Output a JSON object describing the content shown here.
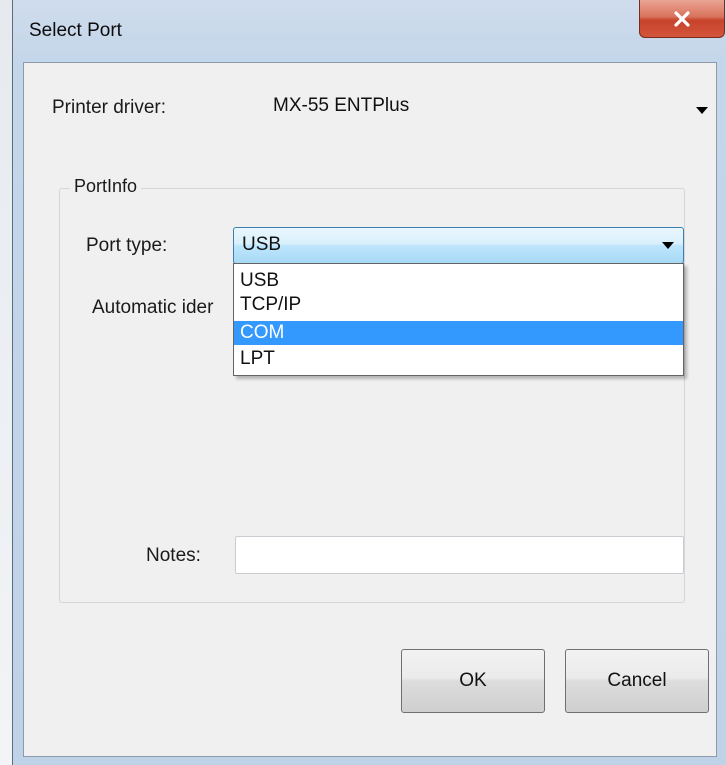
{
  "window": {
    "title": "Select Port"
  },
  "form": {
    "printer_driver_label": "Printer driver:",
    "printer_driver_value": "MX-55 ENTPlus",
    "group_label": "PortInfo",
    "port_type_label": "Port type:",
    "port_type_value": "USB",
    "port_type_options": [
      "USB",
      "TCP/IP",
      "COM",
      "LPT"
    ],
    "highlighted_option": "COM",
    "automatic_label_partial": "Automatic ider",
    "notes_label": "Notes:",
    "notes_value": ""
  },
  "buttons": {
    "ok": "OK",
    "cancel": "Cancel"
  },
  "colors": {
    "selection": "#3399ff",
    "close_button": "#c7432a"
  }
}
